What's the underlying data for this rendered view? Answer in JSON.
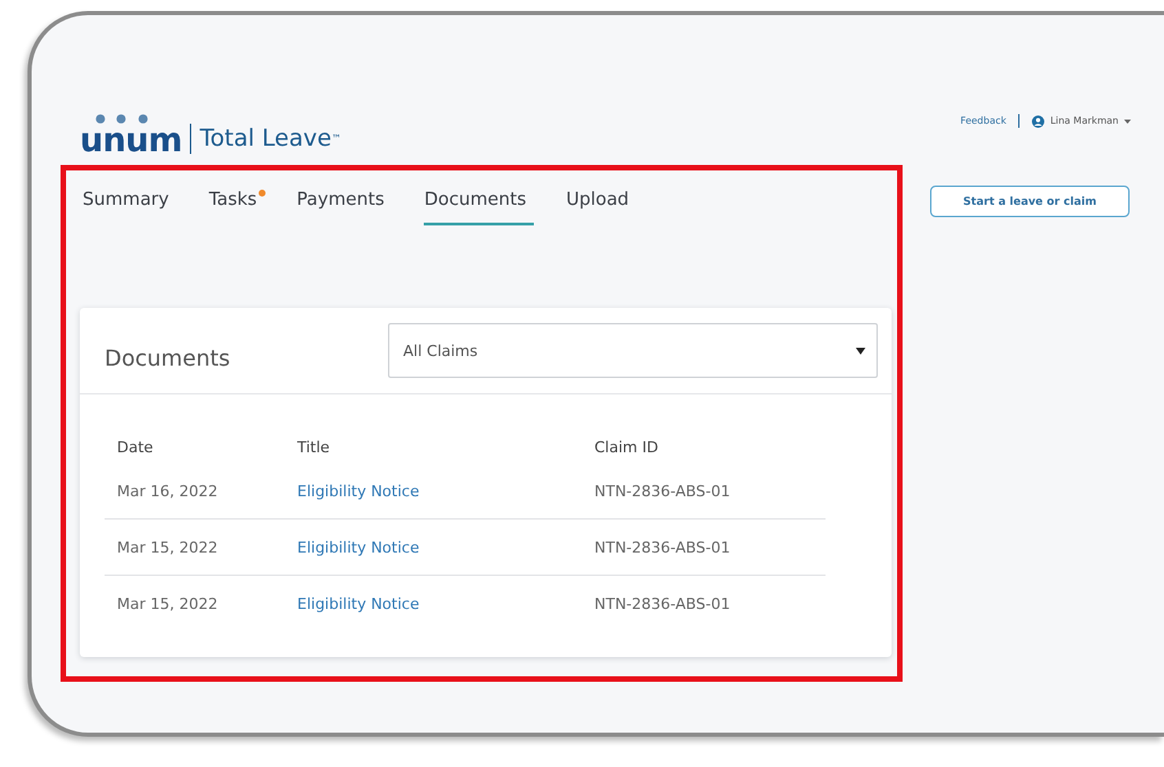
{
  "header": {
    "logo": "unum",
    "product": "Total Leave",
    "trademark": "™",
    "feedback": "Feedback",
    "user": "Lina Markman"
  },
  "tabs": [
    {
      "label": "Summary",
      "selected": false,
      "badge": false
    },
    {
      "label": "Tasks",
      "selected": false,
      "badge": true
    },
    {
      "label": "Payments",
      "selected": false,
      "badge": false
    },
    {
      "label": "Documents",
      "selected": true,
      "badge": false
    },
    {
      "label": "Upload",
      "selected": false,
      "badge": false
    }
  ],
  "start_button": "Start a leave or claim",
  "documents": {
    "title": "Documents",
    "filter": {
      "value": "All Claims"
    },
    "columns": [
      "Date",
      "Title",
      "Claim ID"
    ],
    "rows": [
      {
        "date": "Mar 16, 2022",
        "title": "Eligibility Notice",
        "claim_id": "NTN-2836-ABS-01"
      },
      {
        "date": "Mar 15, 2022",
        "title": "Eligibility Notice",
        "claim_id": "NTN-2836-ABS-01"
      },
      {
        "date": "Mar 15, 2022",
        "title": "Eligibility Notice",
        "claim_id": "NTN-2836-ABS-01"
      }
    ]
  }
}
